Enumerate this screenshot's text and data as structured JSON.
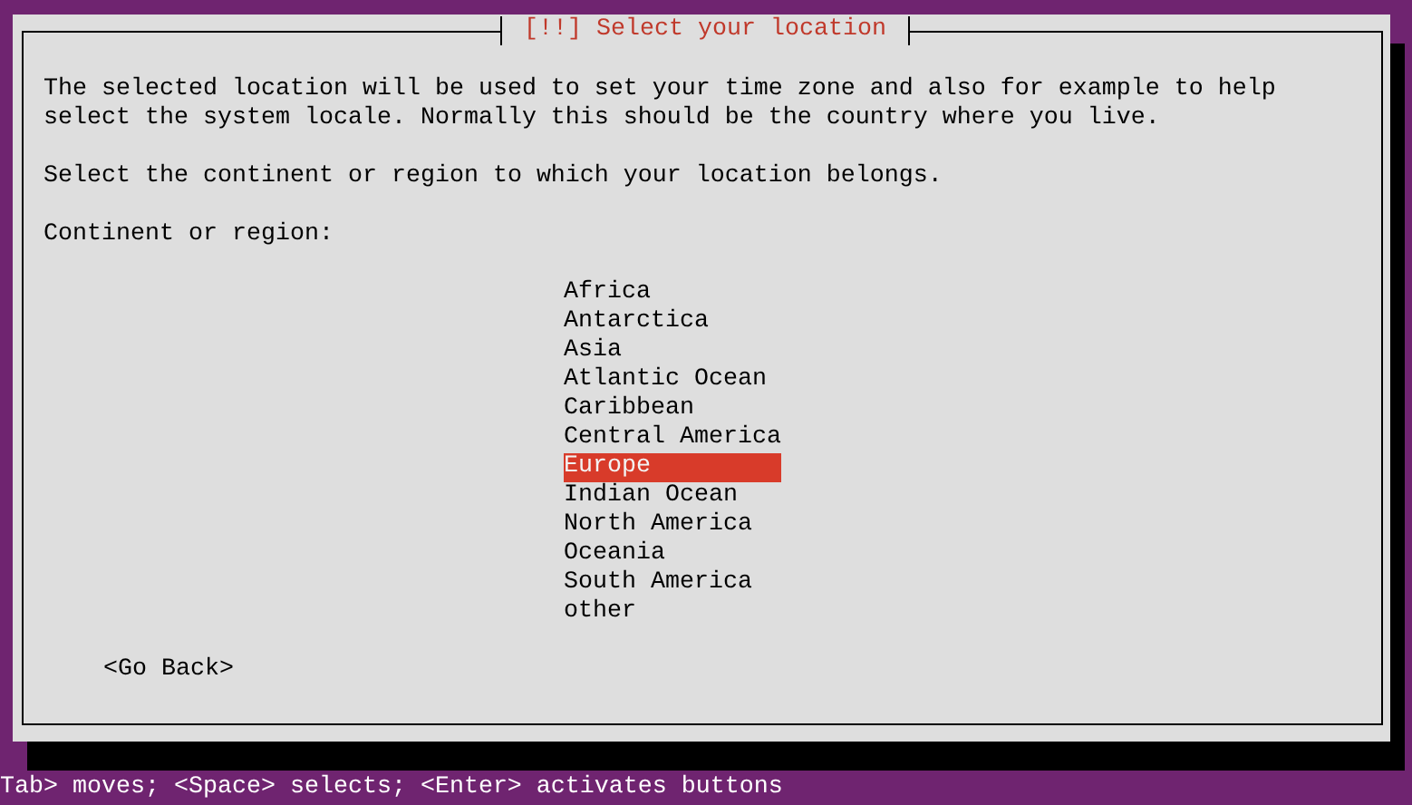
{
  "dialog": {
    "title": "[!!] Select your location",
    "description": "The selected location will be used to set your time zone and also for example to help select the system locale. Normally this should be the country where you live.",
    "prompt": "Select the continent or region to which your location belongs.",
    "field_label": "Continent or region:",
    "regions": [
      {
        "label": "Africa",
        "selected": false
      },
      {
        "label": "Antarctica",
        "selected": false
      },
      {
        "label": "Asia",
        "selected": false
      },
      {
        "label": "Atlantic Ocean",
        "selected": false
      },
      {
        "label": "Caribbean",
        "selected": false
      },
      {
        "label": "Central America",
        "selected": false
      },
      {
        "label": "Europe",
        "selected": true
      },
      {
        "label": "Indian Ocean",
        "selected": false
      },
      {
        "label": "North America",
        "selected": false
      },
      {
        "label": "Oceania",
        "selected": false
      },
      {
        "label": "South America",
        "selected": false
      },
      {
        "label": "other",
        "selected": false
      }
    ],
    "back_button": "<Go Back>"
  },
  "status_bar": "Tab> moves; <Space> selects; <Enter> activates buttons"
}
